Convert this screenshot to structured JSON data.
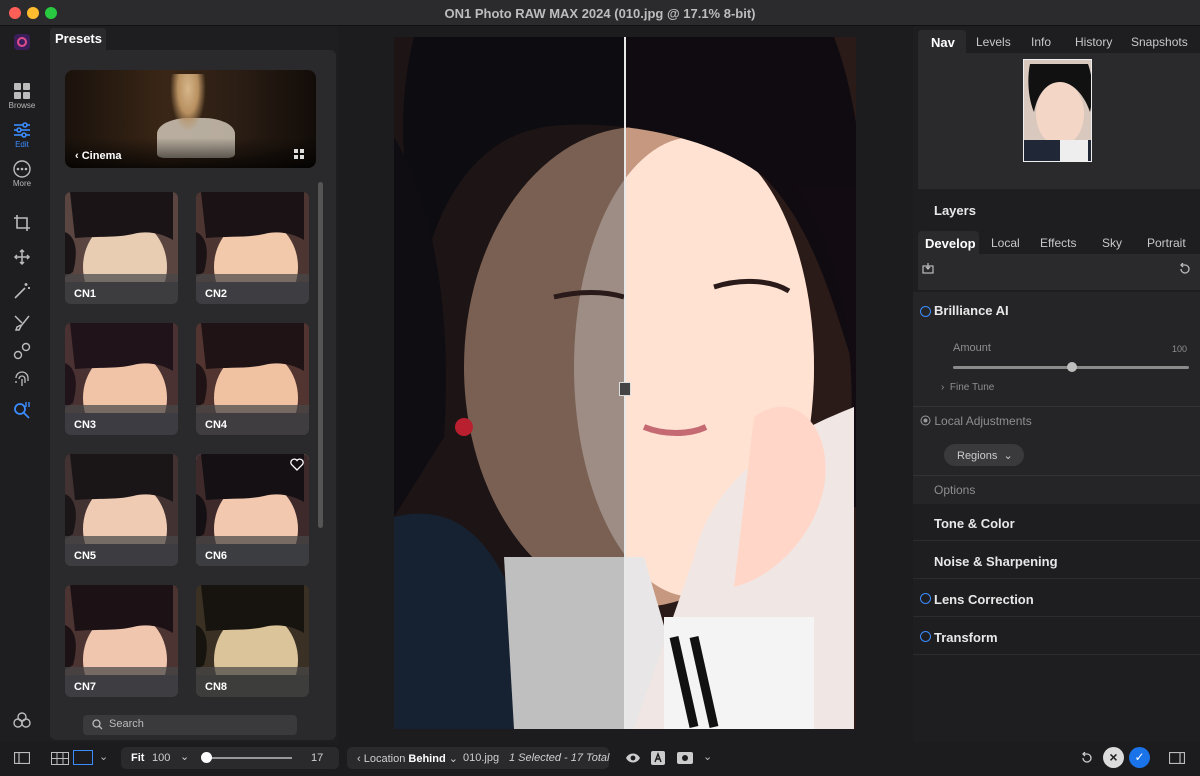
{
  "window": {
    "title": "ON1 Photo RAW MAX 2024 (010.jpg @ 17.1% 8-bit)",
    "traffic_lights": {
      "close": "#ff5f57",
      "minimize": "#febc2e",
      "zoom": "#28c840"
    }
  },
  "left_toolbar": {
    "items": [
      {
        "label": "Browse",
        "icon": "grid-icon"
      },
      {
        "label": "Edit",
        "icon": "sliders-icon",
        "active": true
      },
      {
        "label": "More",
        "icon": "more-icon"
      }
    ],
    "tools": [
      "crop-icon",
      "move-icon",
      "magic-wand-icon",
      "brush-icon",
      "shapes-icon",
      "fingerprint-icon",
      "zoom-tool-icon"
    ],
    "accent": "#3b8cff"
  },
  "presets": {
    "tab_label": "Presets",
    "category": "Cinema",
    "items": [
      {
        "label": "CN1"
      },
      {
        "label": "CN2"
      },
      {
        "label": "CN3"
      },
      {
        "label": "CN4"
      },
      {
        "label": "CN5"
      },
      {
        "label": "CN6",
        "selected": true
      },
      {
        "label": "CN7"
      },
      {
        "label": "CN8"
      }
    ],
    "search_placeholder": "Search"
  },
  "right_panel": {
    "top_tabs": [
      "Nav",
      "Levels",
      "Info",
      "History",
      "Snapshots"
    ],
    "layers_label": "Layers",
    "dev_tabs": [
      "Develop",
      "Local",
      "Effects",
      "Sky",
      "Portrait"
    ],
    "brilliance": {
      "title": "Brilliance AI",
      "amount_label": "Amount",
      "amount_value": "100",
      "fine_tune": "Fine Tune",
      "local_adjustments": "Local Adjustments",
      "regions": "Regions",
      "options": "Options"
    },
    "sections": [
      {
        "label": "Tone & Color",
        "circle": false
      },
      {
        "label": "Noise & Sharpening",
        "circle": false
      },
      {
        "label": "Lens Correction",
        "circle": true
      },
      {
        "label": "Transform",
        "circle": true
      }
    ]
  },
  "bottom_bar": {
    "fit_label": "Fit",
    "zoom_value": "100",
    "zoom_slider": 0.02,
    "slider_end": "17",
    "location_label": "Location",
    "location_value": "Behind",
    "filename": "010.jpg",
    "selection": "1 Selected - 17 Total"
  }
}
